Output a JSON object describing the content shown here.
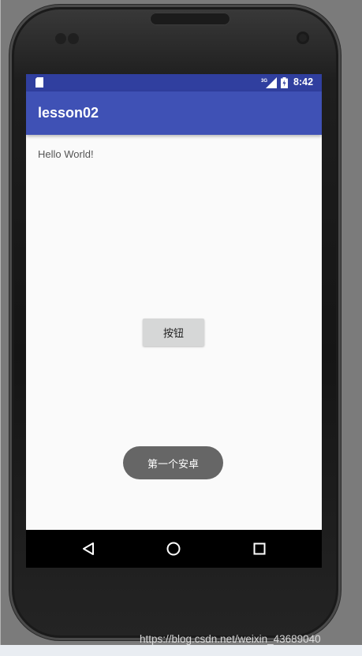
{
  "status_bar": {
    "time": "8:42",
    "network": "3G",
    "icons": [
      "sd-card-icon",
      "signal-icon",
      "battery-icon"
    ]
  },
  "app_bar": {
    "title": "lesson02",
    "color": "#3f51b5"
  },
  "content": {
    "hello_text": "Hello World!",
    "button_label": "按钮",
    "toast_text": "第一个安卓"
  },
  "nav_bar": {
    "icons": [
      "back-icon",
      "home-icon",
      "recent-apps-icon"
    ]
  },
  "colors": {
    "status_bar": "#303f9f",
    "primary": "#3f51b5",
    "toast": "#666666",
    "button": "#d6d7d7"
  },
  "watermark": "https://blog.csdn.net/weixin_43689040"
}
